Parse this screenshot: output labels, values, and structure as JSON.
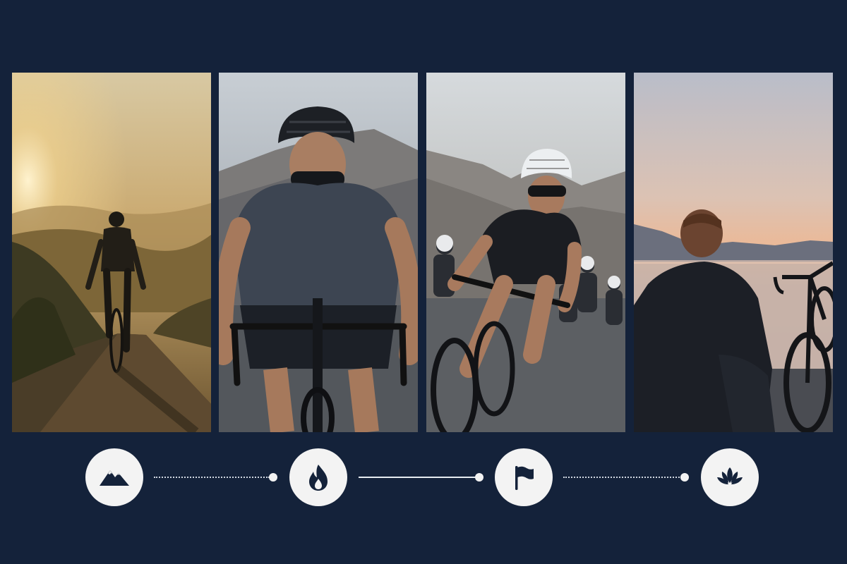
{
  "panels": [
    {
      "scene": "sunrise-ride",
      "colors": {
        "sky_top": "#e6d7ae",
        "sky_low": "#b8955a",
        "ground": "#3a3324"
      }
    },
    {
      "scene": "climb-effort",
      "colors": {
        "sky_top": "#c6ccd2",
        "sky_low": "#9aa3ad",
        "ground": "#4b4f55"
      }
    },
    {
      "scene": "peloton-race",
      "colors": {
        "sky_top": "#cfd4d8",
        "sky_low": "#aeb3b4",
        "ground": "#5a5d60"
      }
    },
    {
      "scene": "lakeside-rest",
      "colors": {
        "sky_top": "#bfc2cd",
        "sky_low": "#e9b89c",
        "ground": "#2b2f38"
      }
    }
  ],
  "steps": [
    {
      "icon": "mountain-icon"
    },
    {
      "icon": "flame-icon"
    },
    {
      "icon": "flag-icon"
    },
    {
      "icon": "lotus-icon"
    }
  ],
  "colors": {
    "background": "#14223a",
    "icon_bg": "#f3f3f3",
    "icon_fg": "#14223a"
  }
}
